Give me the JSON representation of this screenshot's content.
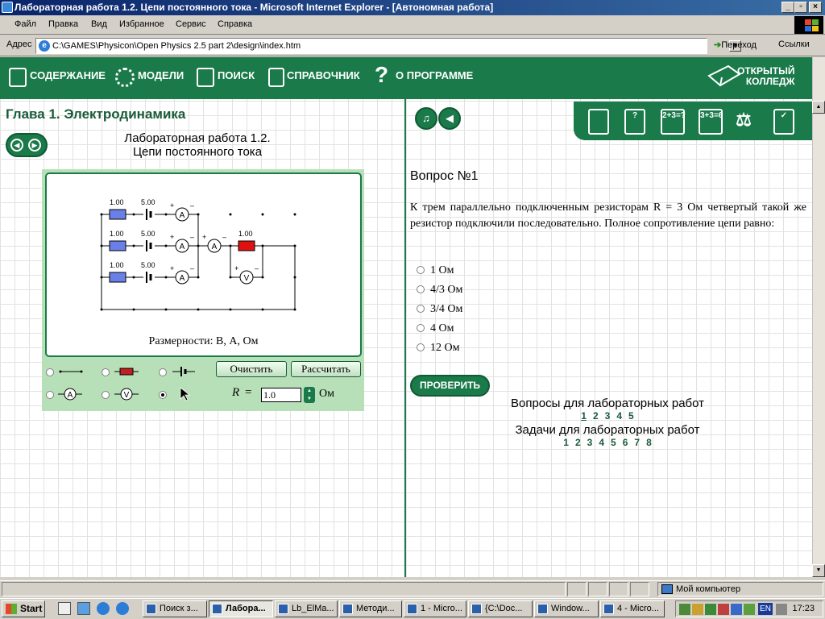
{
  "window": {
    "title": "Лабораторная работа 1.2. Цепи постоянного тока - Microsoft Internet Explorer - [Автономная работа]"
  },
  "menu": [
    "Файл",
    "Правка",
    "Вид",
    "Избранное",
    "Сервис",
    "Справка"
  ],
  "address": {
    "label": "Адрес",
    "url": "C:\\GAMES\\Physicon\\Open Physics 2.5 part 2\\design\\index.htm",
    "go": "Переход",
    "links": "Ссылки"
  },
  "nav": {
    "items": [
      "СОДЕРЖАНИЕ",
      "МОДЕЛИ",
      "ПОИСК",
      "СПРАВОЧНИК",
      "О ПРОГРАММЕ"
    ],
    "brand_line1": "ОТКРЫТЫЙ",
    "brand_line2": "КОЛЛЕДЖ"
  },
  "left": {
    "chapter": "Глава 1. Электродинамика",
    "lab_title_line1": "Лабораторная работа 1.2.",
    "lab_title_line2": "Цепи постоянного тока",
    "dimensions": "Размерности: В, А, Ом",
    "circuit": {
      "r_value": "1.00",
      "emf_value": "5.00",
      "load_value": "1.00",
      "plus": "+",
      "minus": "–",
      "ammeter": "A",
      "voltmeter": "V"
    },
    "clear_button": "Очистить",
    "calc_button": "Рассчитать",
    "r_label": "R",
    "r_eq": "=",
    "r_value": "1.0",
    "r_unit": "Ом"
  },
  "right": {
    "toolbar_icons": [
      "book-icon",
      "help-icon",
      "formula-icon",
      "calc-icon",
      "scales-icon",
      "checklist-icon"
    ],
    "formula_text": "2+3=?",
    "calc_text": "3+3=6",
    "question_title": "Вопрос №1",
    "question_text": "К трем параллельно подключенным резисторам R = 3 Ом четвертый такой же резистор подключили последовательно. Полное сопротивление цепи равно:",
    "options": [
      "1 Ом",
      "4/3 Ом",
      "3/4 Ом",
      "4 Ом",
      "12 Ом"
    ],
    "check_button": "ПРОВЕРИТЬ",
    "lab_questions_heading": "Вопросы для лабораторных работ",
    "lab_questions": [
      "1",
      "2",
      "3",
      "4",
      "5"
    ],
    "tasks_heading": "Задачи для лабораторных работ",
    "tasks": [
      "1",
      "2",
      "3",
      "4",
      "5",
      "6",
      "7",
      "8"
    ]
  },
  "status": {
    "zone": "Мой компьютер"
  },
  "taskbar": {
    "start": "Start",
    "buttons": [
      "Поиск з...",
      "Лабора...",
      "Lb_ElMa...",
      "Методи...",
      "1 - Micro...",
      "{C:\\Doc...",
      "Window...",
      "4 - Micro..."
    ],
    "lang": "EN",
    "clock": "17:23"
  }
}
